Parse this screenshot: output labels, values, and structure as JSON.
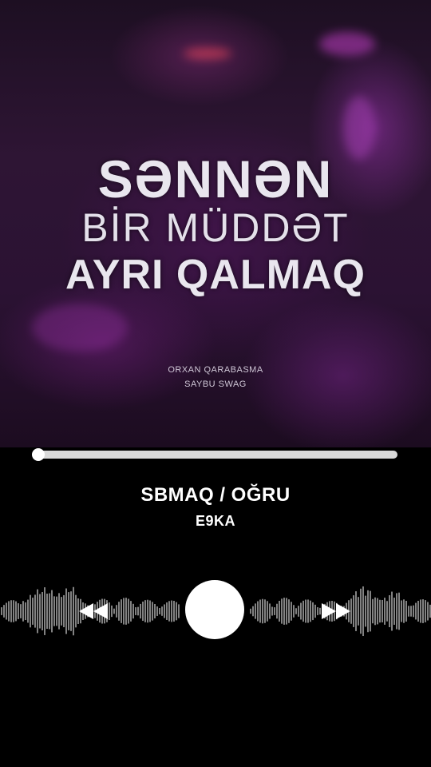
{
  "cover": {
    "line1": "SƏNNƏN",
    "line2": "BİR MÜDDƏT",
    "line3": "AYRI QALMAQ",
    "credit1": "ORXAN QARABASMA",
    "credit2": "SAYBU SWAG"
  },
  "player": {
    "progress": 0.0,
    "title": "SBMAQ / OĞRU",
    "artist": "E9KA"
  },
  "icons": {
    "rewind": "rewind-icon",
    "play": "play-button-circle",
    "forward": "fast-forward-icon"
  },
  "colors": {
    "background": "#000000",
    "progress_track": "#d9d9d9",
    "accent": "#ffffff"
  }
}
